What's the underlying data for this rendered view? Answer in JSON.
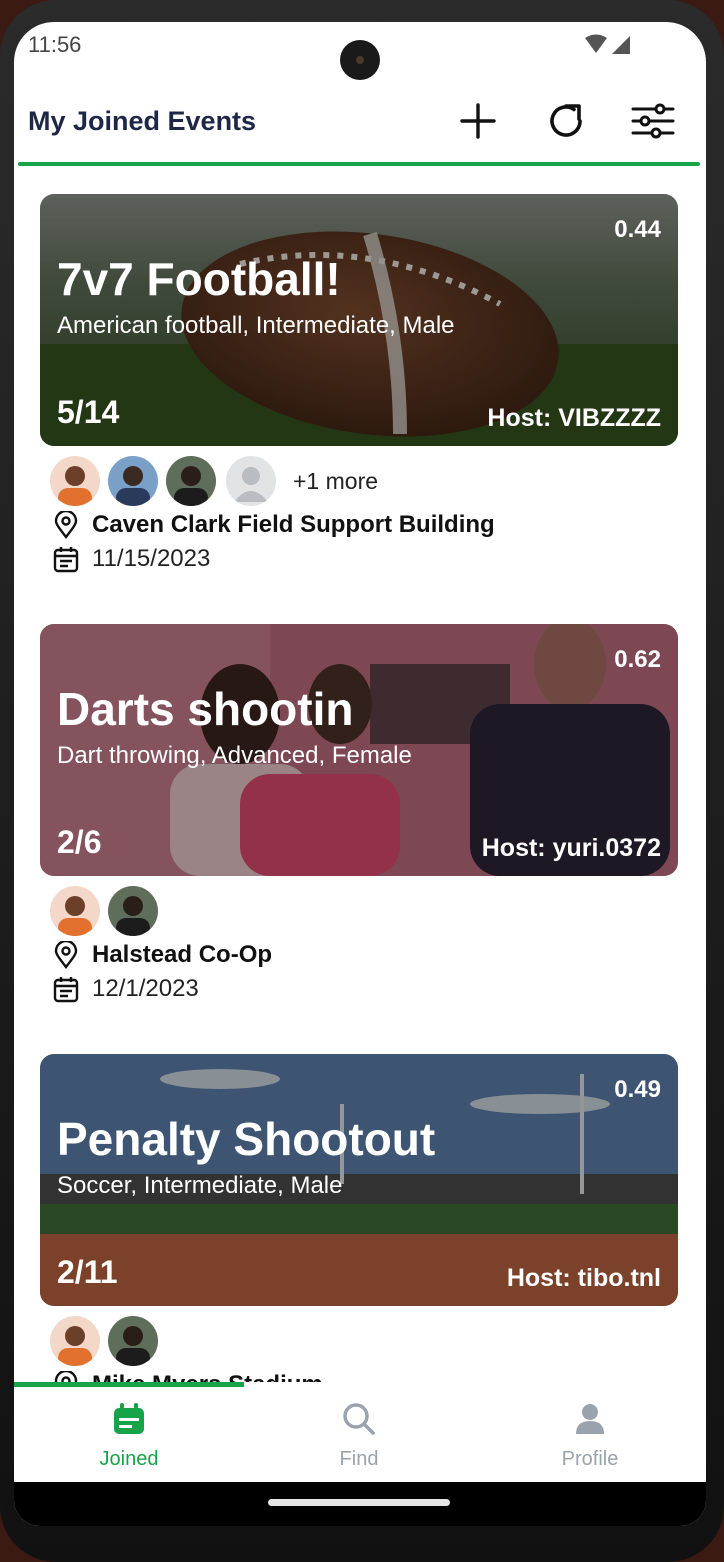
{
  "status_bar": {
    "time": "11:56"
  },
  "header": {
    "title": "My Joined Events",
    "add_icon": "plus-icon",
    "refresh_icon": "refresh-icon",
    "filter_icon": "sliders-icon"
  },
  "events": [
    {
      "title": "7v7 Football!",
      "subtitle": "American football, Intermediate, Male",
      "score": "0.44",
      "count": "5/14",
      "host": "Host: VIBZZZZ",
      "more": "+1 more",
      "location": "Caven Clark Field Support Building",
      "date": "11/15/2023"
    },
    {
      "title": "Darts shootin",
      "subtitle": "Dart throwing, Advanced, Female",
      "score": "0.62",
      "count": "2/6",
      "host": "Host: yuri.0372",
      "location": "Halstead Co-Op",
      "date": "12/1/2023"
    },
    {
      "title": "Penalty Shootout",
      "subtitle": "Soccer, Intermediate, Male",
      "score": "0.49",
      "count": "2/11",
      "host": "Host: tibo.tnl",
      "location": "Mike Myers Stadium"
    }
  ],
  "bottom_nav": [
    {
      "label": "Joined",
      "icon": "calendar-icon",
      "active": true
    },
    {
      "label": "Find",
      "icon": "search-icon",
      "active": false
    },
    {
      "label": "Profile",
      "icon": "person-icon",
      "active": false
    }
  ],
  "colors": {
    "accent": "#16a34a",
    "title": "#1f2747",
    "inactive": "#9aa3ad"
  }
}
